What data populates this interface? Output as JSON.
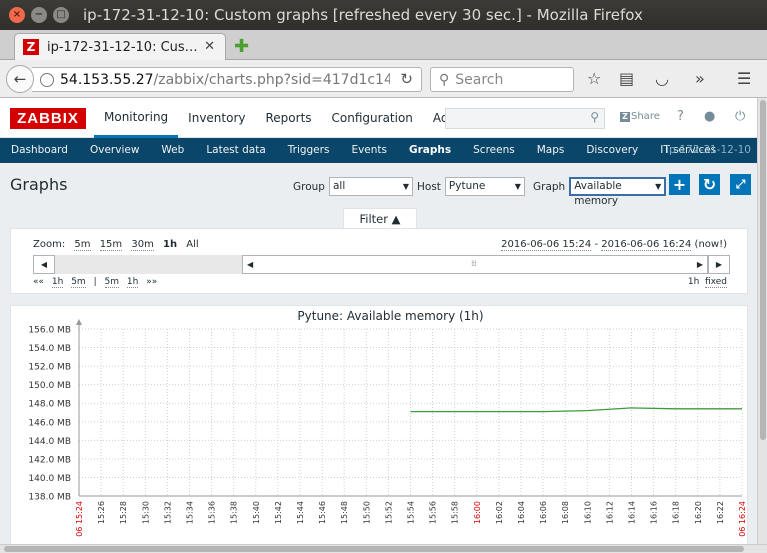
{
  "window": {
    "title": "ip-172-31-12-10: Custom graphs [refreshed every 30 sec.] - Mozilla Firefox"
  },
  "browser": {
    "tab_title": "ip-172-31-12-10: Cus…",
    "tab_favicon": "Z",
    "url_host": "54.153.55.27",
    "url_path": "/zabbix/charts.php?sid=417d1c14",
    "search_placeholder": "Search"
  },
  "zabbix": {
    "logo": "ZABBIX",
    "main_menu": [
      "Monitoring",
      "Inventory",
      "Reports",
      "Configuration",
      "Administration"
    ],
    "active_main": "Monitoring",
    "share_label": "Share",
    "sub_menu": [
      "Dashboard",
      "Overview",
      "Web",
      "Latest data",
      "Triggers",
      "Events",
      "Graphs",
      "Screens",
      "Maps",
      "Discovery",
      "IT services"
    ],
    "active_sub": "Graphs",
    "host_label": "ip-172-31-12-10"
  },
  "header": {
    "page_title": "Graphs",
    "group_label": "Group",
    "group_value": "all",
    "host_label": "Host",
    "host_value": "Pytune",
    "graph_label": "Graph",
    "graph_value": "Available memory"
  },
  "filter": {
    "label": "Filter ▲"
  },
  "timeline": {
    "zoom_label": "Zoom:",
    "zoom_options": [
      "5m",
      "15m",
      "30m",
      "1h",
      "All"
    ],
    "zoom_active": "1h",
    "range_from": "2016-06-06 15:24",
    "range_sep": " - ",
    "range_to": "2016-06-06 16:24",
    "range_now": "(now!)",
    "nav_left": [
      "««",
      "1h",
      "5m",
      "|",
      "5m",
      "1h",
      "»»"
    ],
    "period": "1h",
    "fixed": "fixed"
  },
  "colors": {
    "line": "#3c9c3c",
    "grid": "#cfcfcf",
    "red_label": "#dc0000",
    "zabbix_red": "#d40000",
    "subnav_bg": "#0a466a"
  },
  "chart_data": {
    "type": "line",
    "title": "Pytune: Available memory (1h)",
    "y_tick_labels": [
      "138.0 MB",
      "140.0 MB",
      "142.0 MB",
      "144.0 MB",
      "146.0 MB",
      "148.0 MB",
      "150.0 MB",
      "152.0 MB",
      "154.0 MB",
      "156.0 MB"
    ],
    "ylim": [
      138,
      156
    ],
    "x_range_minutes": [
      0,
      60
    ],
    "x_tick_labels": [
      "06 15:24",
      "15:26",
      "15:28",
      "15:30",
      "15:32",
      "15:34",
      "15:36",
      "15:38",
      "15:40",
      "15:42",
      "15:44",
      "15:46",
      "15:48",
      "15:50",
      "15:52",
      "15:54",
      "15:56",
      "15:58",
      "16:00",
      "16:02",
      "16:04",
      "16:06",
      "16:08",
      "16:10",
      "16:12",
      "16:14",
      "16:16",
      "16:18",
      "16:20",
      "16:22",
      "06 16:24"
    ],
    "red_x_labels": [
      "06 15:24",
      "16:00",
      "06 16:24"
    ],
    "grid": true,
    "series": [
      {
        "x": [
          "15:54",
          "15:58",
          "16:02",
          "16:06",
          "16:10",
          "16:14",
          "16:18",
          "16:22",
          "16:24"
        ],
        "values": [
          147.1,
          147.1,
          147.1,
          147.1,
          147.2,
          147.5,
          147.4,
          147.4,
          147.4
        ]
      }
    ]
  }
}
